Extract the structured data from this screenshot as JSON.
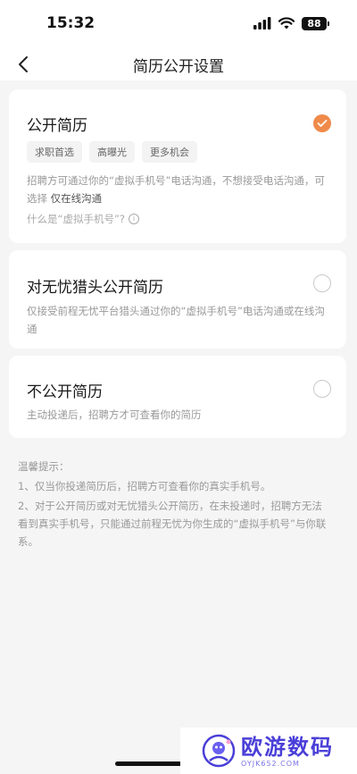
{
  "status_bar": {
    "time": "15:32",
    "battery": "88"
  },
  "nav": {
    "title": "简历公开设置"
  },
  "options": [
    {
      "title": "公开简历",
      "selected": true,
      "tags": [
        "求职首选",
        "高曝光",
        "更多机会"
      ],
      "desc_part1": "招聘方可通过你的“虚拟手机号”电话沟通，不想接受电话沟通，可选择",
      "desc_highlight": "仅在线沟通",
      "help_text": "什么是“虚拟手机号”?"
    },
    {
      "title": "对无忧猎头公开简历",
      "selected": false,
      "desc": "仅接受前程无忧平台猎头通过你的“虚拟手机号”电话沟通或在线沟通"
    },
    {
      "title": "不公开简历",
      "selected": false,
      "desc": "主动投递后，招聘方才可查看你的简历"
    }
  ],
  "tips": {
    "heading": "温馨提示：",
    "items": [
      "1、仅当你投递简历后，招聘方可查看你的真实手机号。",
      "2、对于公开简历或对无忧猎头公开简历，在未投递时，招聘方无法看到真实手机号，只能通过前程无忧为你生成的“虚拟手机号”与你联系。"
    ]
  },
  "watermark": {
    "name": "欧游数码",
    "url": "OYJK652.COM"
  },
  "colors": {
    "accent": "#ef8a4a",
    "watermark": "#4a3fd8"
  }
}
